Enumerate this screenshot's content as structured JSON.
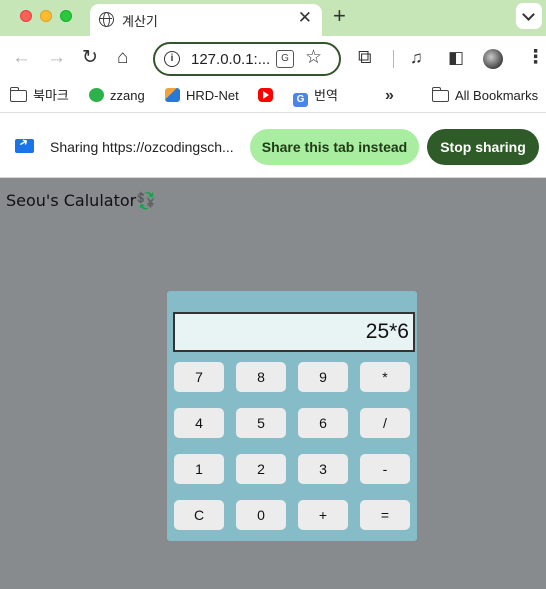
{
  "window": {
    "tab_title": "계산기",
    "new_tab_label": "+",
    "close_label": "✕"
  },
  "toolbar": {
    "url": "127.0.0.1:...",
    "back": "←",
    "forward": "→",
    "reload": "↻",
    "home": "⌂",
    "star": "☆",
    "extensions": "⧉",
    "media": "♫",
    "sidepanel": "◧",
    "menu": "⋮"
  },
  "bookmarks": {
    "items": [
      {
        "label": "북마크",
        "icon": "folder-icon"
      },
      {
        "label": "zzang",
        "icon": "zzang-icon"
      },
      {
        "label": "HRD-Net",
        "icon": "hrd-net-icon"
      },
      {
        "label": "",
        "icon": "youtube-icon"
      },
      {
        "label": "번역",
        "icon": "google-translate-icon"
      }
    ],
    "more": "»",
    "all_bookmarks": "All Bookmarks"
  },
  "sharing": {
    "text": "Sharing https://ozcodingsch...",
    "share_tab_label": "Share this tab instead",
    "stop_label": "Stop sharing"
  },
  "page": {
    "title": "Seou's Calulator💱"
  },
  "calculator": {
    "display": "25*6",
    "keys": [
      [
        "7",
        "8",
        "9",
        "*"
      ],
      [
        "4",
        "5",
        "6",
        "/"
      ],
      [
        "1",
        "2",
        "3",
        "-"
      ],
      [
        "C",
        "0",
        "+",
        "="
      ]
    ]
  },
  "colors": {
    "tab_strip": "#c6e6b7",
    "page_bg": "#888b8d",
    "calc_bg": "#86bcc8",
    "display_bg": "#e8f4f4",
    "key_bg": "#ececec",
    "share_button": "#a9eda0",
    "stop_button": "#2e5b27"
  }
}
